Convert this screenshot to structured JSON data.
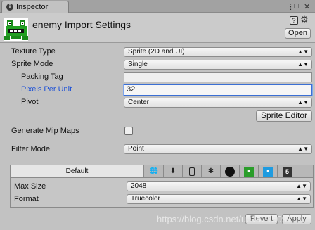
{
  "window": {
    "tab_label": "Inspector",
    "tab_icon": "info-icon",
    "menu_glyph": "⋮",
    "minimize_glyph": "□",
    "close_glyph": "✕"
  },
  "header": {
    "title": "enemy Import Settings",
    "open_button": "Open",
    "help_icon": "book-help-icon",
    "settings_icon": "gear-icon"
  },
  "settings": {
    "texture_type": {
      "label": "Texture Type",
      "value": "Sprite (2D and UI)"
    },
    "sprite_mode": {
      "label": "Sprite Mode",
      "value": "Single"
    },
    "packing_tag": {
      "label": "Packing Tag",
      "value": ""
    },
    "pixels_per_unit": {
      "label": "Pixels Per Unit",
      "value": "32"
    },
    "pivot": {
      "label": "Pivot",
      "value": "Center"
    },
    "sprite_editor_button": "Sprite Editor",
    "generate_mip_maps": {
      "label": "Generate Mip Maps",
      "checked": false
    },
    "filter_mode": {
      "label": "Filter Mode",
      "value": "Point"
    }
  },
  "platforms": {
    "default_tab": "Default",
    "tab_icons": [
      "globe-icon",
      "download-icon",
      "phone-icon",
      "android-icon",
      "blackberry-icon",
      "xbox-icon",
      "windows-store-icon",
      "html5-icon"
    ],
    "max_size": {
      "label": "Max Size",
      "value": "2048"
    },
    "format": {
      "label": "Format",
      "value": "Truecolor"
    }
  },
  "footer": {
    "revert_button": "Revert",
    "apply_button": "Apply",
    "watermark": "https://blog.csdn.net/u014215097"
  }
}
